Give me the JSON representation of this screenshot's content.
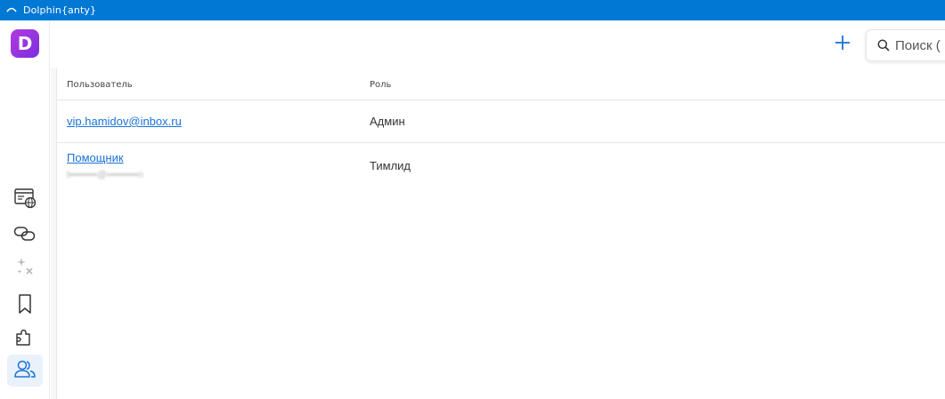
{
  "window": {
    "title": "Dolphin{anty}"
  },
  "sidebar": {
    "logo_letter": "D",
    "items": [
      {
        "icon": "browser-globe-icon"
      },
      {
        "icon": "proxy-link-icon"
      },
      {
        "icon": "sparkle-automation-icon"
      },
      {
        "icon": "bookmark-icon"
      },
      {
        "icon": "extension-puzzle-icon"
      },
      {
        "icon": "users-icon",
        "active": true
      }
    ]
  },
  "toolbar": {
    "add_icon": "plus-icon",
    "search_placeholder": "Поиск (",
    "search_icon": "search-icon"
  },
  "table": {
    "columns": [
      "Пользователь",
      "Роль"
    ],
    "rows": [
      {
        "user": "vip.hamidov@inbox.ru",
        "user_sub": "",
        "role": "Админ"
      },
      {
        "user": "Помощник",
        "user_sub": "t••••••••@•••••••••n",
        "role": "Тимлид"
      }
    ]
  },
  "colors": {
    "titlebar": "#0078d4",
    "accent": "#1a73d9",
    "logo": "#9b35df",
    "active_bg": "#e9f1fb"
  }
}
